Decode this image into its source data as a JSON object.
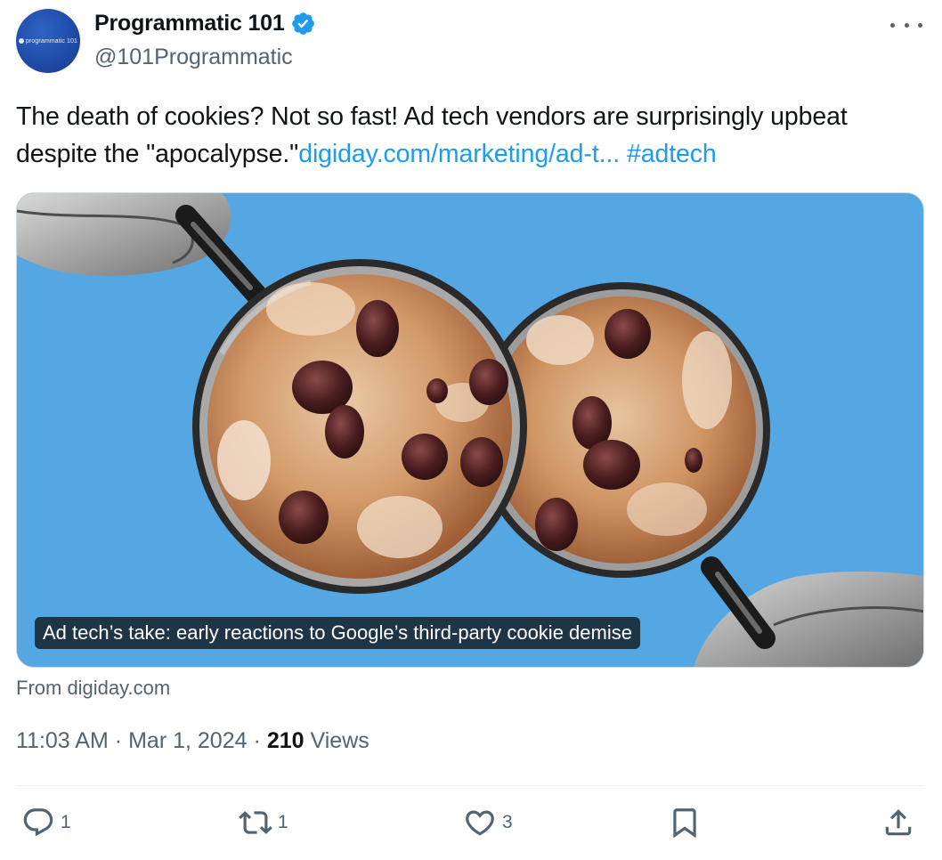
{
  "author": {
    "display_name": "Programmatic 101",
    "handle": "@101Programmatic",
    "avatar_text": "programmatic 101",
    "verified": true
  },
  "tweet": {
    "text": "The death of cookies? Not so fast! Ad tech vendors are surprisingly upbeat despite the \"apocalypse.\"",
    "link_text": "digiday.com/marketing/ad-t...",
    "hashtag": "#adtech"
  },
  "card": {
    "caption": "Ad tech’s take: early reactions to Google’s third-party cookie demise",
    "source": "From digiday.com",
    "background_color": "#55a7e4"
  },
  "meta": {
    "time": "11:03 AM",
    "separator": "·",
    "date": "Mar 1, 2024",
    "views_count": "210",
    "views_label": "Views"
  },
  "actions": {
    "replies": "1",
    "reposts": "1",
    "likes": "3"
  },
  "icons": {
    "verified": "verified-badge-icon",
    "more": "more-icon",
    "reply": "reply-icon",
    "repost": "repost-icon",
    "like": "heart-icon",
    "bookmark": "bookmark-icon",
    "share": "share-icon"
  },
  "colors": {
    "link": "#1d9bf0",
    "secondary_text": "#536471",
    "primary_text": "#0f1419"
  }
}
